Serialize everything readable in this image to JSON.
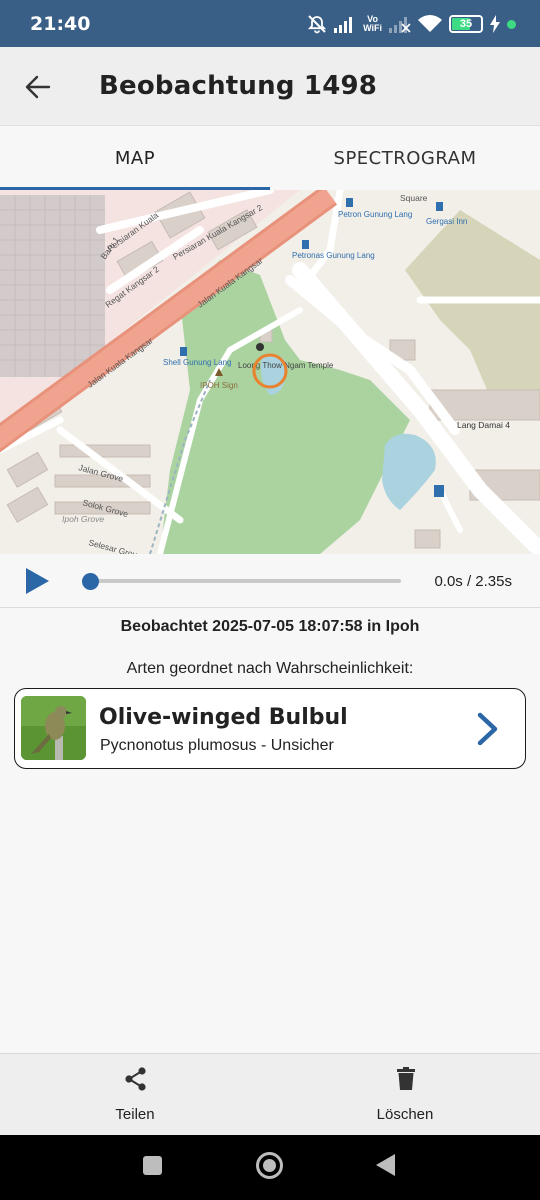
{
  "status_bar": {
    "time": "21:40",
    "vowifi_top": "Vo",
    "vowifi_bottom": "WiFi",
    "battery": "35",
    "icons": [
      "mute-bell-icon",
      "signal-icon",
      "vowifi-icon",
      "signal-empty-icon",
      "wifi-icon",
      "battery-icon",
      "charging-icon"
    ]
  },
  "app_bar": {
    "title": "Beobachtung 1498",
    "back_icon": "arrow-back-icon"
  },
  "tabs": [
    {
      "label": "MAP",
      "selected": true
    },
    {
      "label": "SPECTROGRAM",
      "selected": false
    }
  ],
  "map": {
    "labels": {
      "road_kangsar": "Jalan Kuala Kangsar",
      "road_kangsar2": "Jalan Kuala Kangsar",
      "persiaran1": "Persiaran Kuala",
      "persiaran2": "Persiaran Kuala Kangsar 2",
      "baru": "Baru 1",
      "regat": "Regat Kangsar 2",
      "petron": "Petron Gunung Lang",
      "petronas": "Petronas Gunung Lang",
      "gergasi": "Gergasi Inn",
      "square": "Square",
      "shell": "Shell Gunung Lang",
      "ipoh_sign": "IPOH Sign",
      "temple": "Loong Thow Ngam Temple",
      "lang_damai": "Lang Damai 4",
      "jalan_grove": "Jalan Grove",
      "solok_grove": "Solok Grove",
      "ipoh_grove": "Ipoh Grove",
      "selesar_grove": "Selesar Grove"
    }
  },
  "player": {
    "time": "0.0s / 2.35s",
    "progress": 0.0
  },
  "observation": {
    "observed_text": "Beobachtet 2025-07-05 18:07:58 in Ipoh",
    "sorted_label": "Arten geordnet nach Wahrscheinlichkeit:"
  },
  "species": [
    {
      "common_name": "Olive-winged Bulbul",
      "subtitle": "Pycnonotus plumosus - Unsicher"
    }
  ],
  "bottom_bar": {
    "share_label": "Teilen",
    "delete_label": "Löschen"
  },
  "colors": {
    "status_bar": "#3a5f86",
    "accent": "#2b66a6",
    "app_bar": "#eeeeee",
    "background": "#f7f7f7"
  }
}
